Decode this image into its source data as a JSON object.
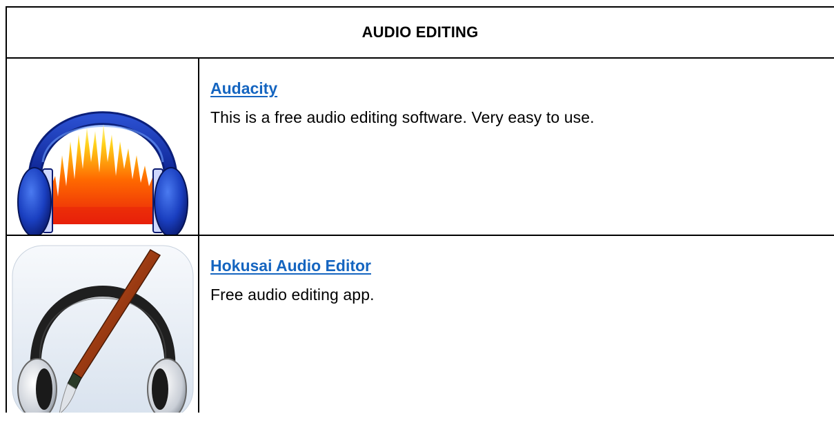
{
  "header": {
    "title": "AUDIO EDITING"
  },
  "entries": [
    {
      "name": "Audacity",
      "description": "This is a free audio editing software. Very easy to use.",
      "icon": "audacity-headphones-icon"
    },
    {
      "name": "Hokusai Audio Editor",
      "description": "Free audio editing app.",
      "icon": "hokusai-headphones-brush-icon"
    }
  ],
  "colors": {
    "link": "#1565c0",
    "border": "#000000"
  }
}
